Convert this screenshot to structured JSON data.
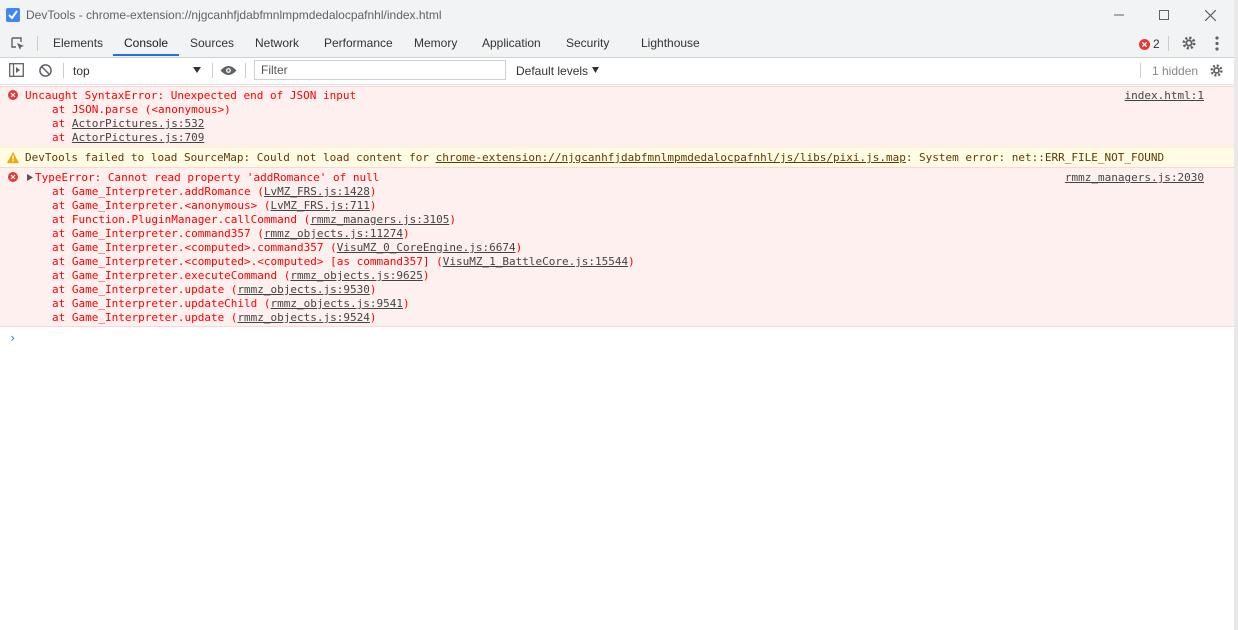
{
  "window": {
    "title": "DevTools - chrome-extension://njgcanhfjdabfmnlmpmdedalocpafnhl/index.html"
  },
  "tabs": [
    "Elements",
    "Console",
    "Sources",
    "Network",
    "Performance",
    "Memory",
    "Application",
    "Security",
    "Lighthouse"
  ],
  "active_tab": "Console",
  "error_count": "2",
  "toolbar": {
    "context": "top",
    "filter_placeholder": "Filter",
    "levels": "Default levels",
    "hidden": "1 hidden"
  },
  "messages": {
    "m1": {
      "text": "Uncaught SyntaxError: Unexpected end of JSON input",
      "source": "index.html:1",
      "s1": "at JSON.parse (<anonymous>)",
      "s2_pre": "at ",
      "s2_link": "ActorPictures.js:532",
      "s3_pre": "at ",
      "s3_link": "ActorPictures.js:709"
    },
    "m2": {
      "pre": "DevTools failed to load SourceMap: Could not load content for ",
      "link": "chrome-extension://njgcanhfjdabfmnlmpmdedalocpafnhl/js/libs/pixi.js.map",
      "post": ": System error: net::ERR_FILE_NOT_FOUND"
    },
    "m3": {
      "text": "TypeError: Cannot read property 'addRomance' of null",
      "source": "rmmz_managers.js:2030",
      "stack": [
        {
          "pre": "at Game_Interpreter.addRomance (",
          "link": "LvMZ_FRS.js:1428",
          "post": ")"
        },
        {
          "pre": "at Game_Interpreter.<anonymous> (",
          "link": "LvMZ_FRS.js:711",
          "post": ")"
        },
        {
          "pre": "at Function.PluginManager.callCommand (",
          "link": "rmmz_managers.js:3105",
          "post": ")"
        },
        {
          "pre": "at Game_Interpreter.command357 (",
          "link": "rmmz_objects.js:11274",
          "post": ")"
        },
        {
          "pre": "at Game_Interpreter.<computed>.command357 (",
          "link": "VisuMZ_0_CoreEngine.js:6674",
          "post": ")"
        },
        {
          "pre": "at Game_Interpreter.<computed>.<computed> [as command357] (",
          "link": "VisuMZ_1_BattleCore.js:15544",
          "post": ")"
        },
        {
          "pre": "at Game_Interpreter.executeCommand (",
          "link": "rmmz_objects.js:9625",
          "post": ")"
        },
        {
          "pre": "at Game_Interpreter.update (",
          "link": "rmmz_objects.js:9530",
          "post": ")"
        },
        {
          "pre": "at Game_Interpreter.updateChild (",
          "link": "rmmz_objects.js:9541",
          "post": ")"
        },
        {
          "pre": "at Game_Interpreter.update (",
          "link": "rmmz_objects.js:9524",
          "post": ")"
        }
      ]
    }
  },
  "prompt": "›",
  "colors": {
    "accent": "#1a73e8",
    "error_text": "#ff0000",
    "error_bg": "#fff0f0",
    "warning_bg": "#fffbe5"
  },
  "icons": [
    "devtools-app-icon",
    "minimize-icon",
    "maximize-icon",
    "close-icon",
    "inspect-element-icon",
    "error-circle-icon",
    "gear-icon",
    "kebab-menu-icon",
    "sidebar-toggle-icon",
    "clear-console-icon",
    "dropdown-arrow-icon",
    "eye-icon",
    "warning-triangle-icon",
    "expand-triangle-icon",
    "prompt-chevron-icon"
  ]
}
